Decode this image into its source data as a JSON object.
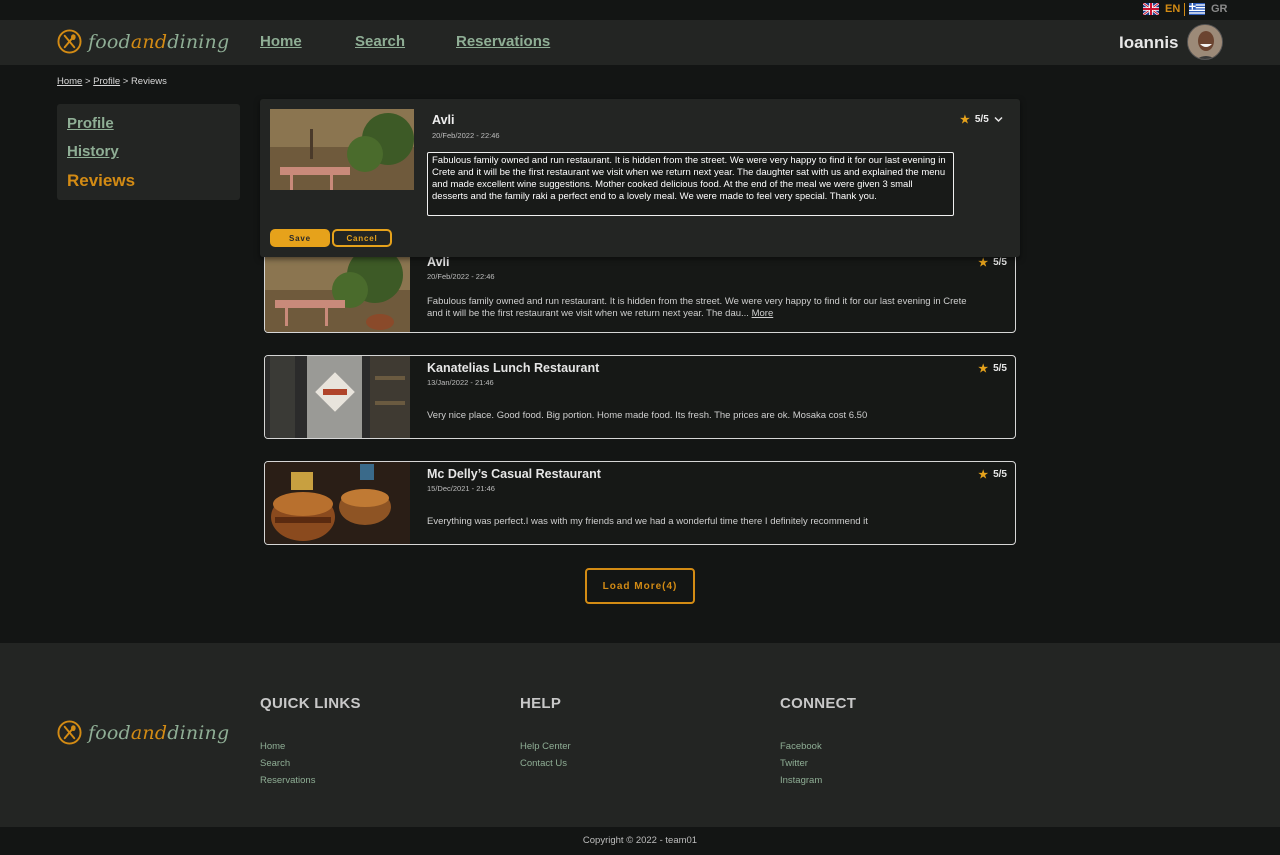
{
  "languages": [
    {
      "code": "EN",
      "flag": "uk-flag-icon",
      "active": true
    },
    {
      "code": "GR",
      "flag": "greece-flag-icon",
      "active": false
    }
  ],
  "brand": {
    "part1": "food",
    "part2": "and",
    "part3": "dining"
  },
  "nav": {
    "home": "Home",
    "search": "Search",
    "reservations": "Reservations"
  },
  "user": {
    "name": "Ioannis"
  },
  "breadcrumb": {
    "home": "Home",
    "sep1": " > ",
    "profile": "Profile",
    "sep2": " > ",
    "current": "Reviews"
  },
  "sidebar": {
    "profile": "Profile",
    "history": "History",
    "reviews": "Reviews"
  },
  "edit": {
    "title": "Avli",
    "date": "20/Feb/2022 - 22:46",
    "rating": "5/5",
    "text": "Fabulous family owned and run restaurant. It is hidden from the street. We were very happy to find it for our last evening in Crete and it will be the first restaurant we visit when we return next year. The daughter sat with us and explained the menu and made excellent wine suggestions. Mother cooked delicious food. At the end of the meal we were given 3 small desserts and the family raki a perfect end to a lovely meal. We were made to feel very special. Thank you.",
    "save": "Save",
    "cancel": "Cancel"
  },
  "reviews": [
    {
      "title": "Avli",
      "date": "20/Feb/2022 - 22:46",
      "rating": "5/5",
      "text": "Fabulous family owned and run restaurant. It is hidden from the street. We were very happy to find it for our last evening in Crete and it will be the first restaurant we visit when we return next year. The dau...",
      "more": "More"
    },
    {
      "title": "Kanatelias Lunch Restaurant",
      "date": "13/Jan/2022 - 21:46",
      "rating": "5/5",
      "text": "Very nice place. Good food. Big portion. Home made food. Its fresh. The prices are ok. Mosaka cost 6.50"
    },
    {
      "title": "Mc Delly’s Casual Restaurant",
      "date": "15/Dec/2021 - 21:46",
      "rating": "5/5",
      "text": "Everything was perfect.I was with my friends and we had a wonderful time there I definitely recommend it"
    }
  ],
  "load_more": "Load More(4)",
  "footer": {
    "quick_links": {
      "title": "QUICK LINKS",
      "items": [
        "Home",
        "Search",
        "Reservations"
      ]
    },
    "help": {
      "title": "HELP",
      "items": [
        "Help Center",
        "Contact Us"
      ]
    },
    "connect": {
      "title": "CONNECT",
      "items": [
        "Facebook",
        "Twitter",
        "Instagram"
      ]
    }
  },
  "copyright": "Copyright © 2022 - team01",
  "colors": {
    "accent": "#d38b14",
    "link": "#8fae95",
    "panel": "#232523",
    "background": "#131514"
  }
}
